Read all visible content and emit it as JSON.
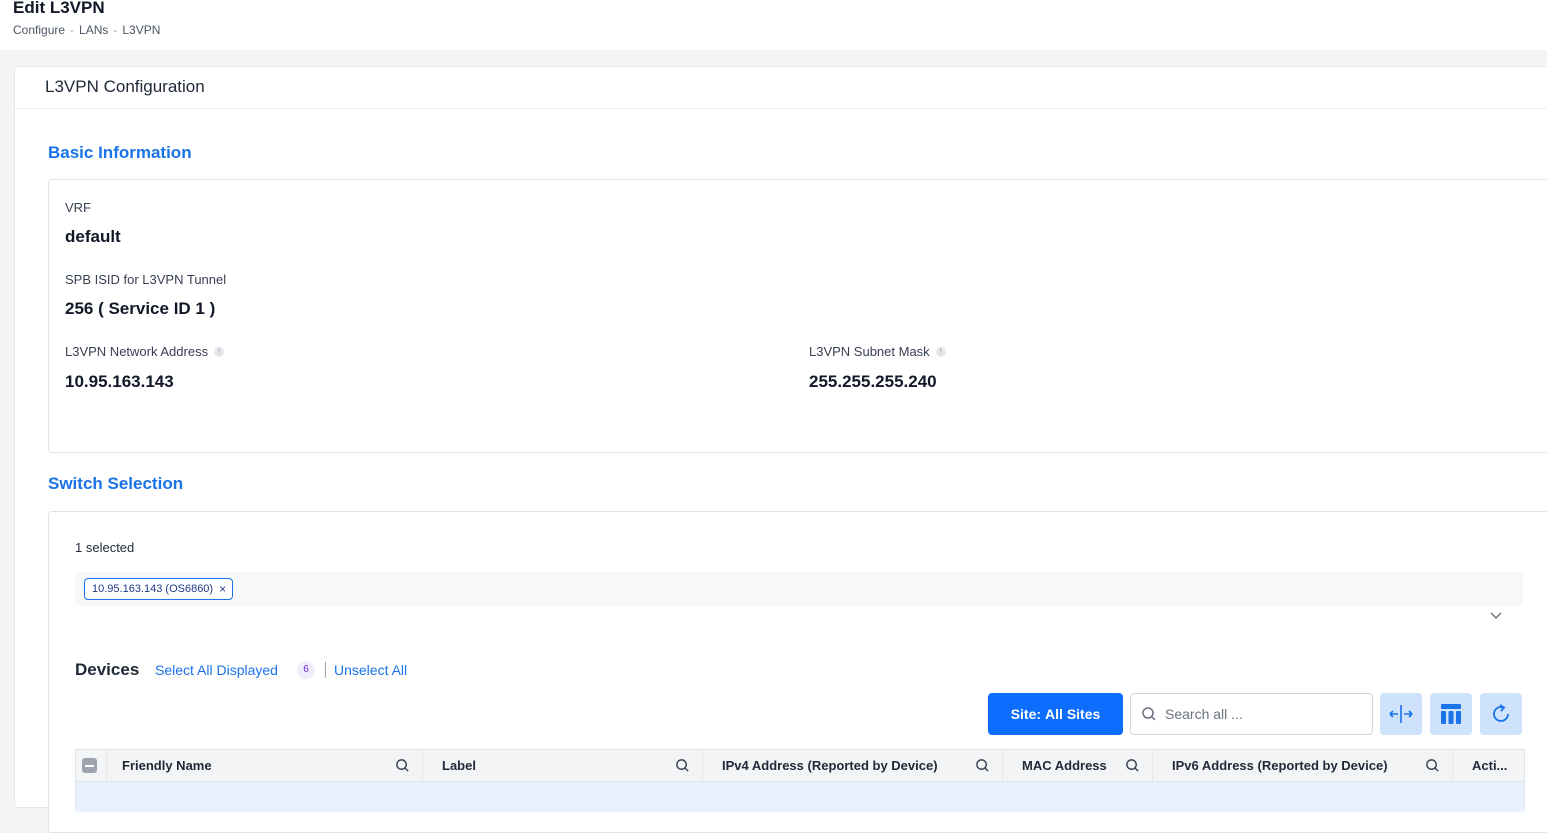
{
  "header": {
    "title": "Edit L3VPN",
    "breadcrumb": [
      "Configure",
      "LANs",
      "L3VPN"
    ],
    "separator": "-"
  },
  "panel": {
    "title": "L3VPN Configuration"
  },
  "basic_info": {
    "section_title": "Basic Information",
    "vrf_label": "VRF",
    "vrf_value": "default",
    "isid_label": "SPB ISID for L3VPN Tunnel",
    "isid_value": "256 ( Service ID 1 )",
    "network_address_label": "L3VPN Network Address",
    "network_address_value": "10.95.163.143",
    "subnet_mask_label": "L3VPN Subnet Mask",
    "subnet_mask_value": "255.255.255.240"
  },
  "switch_selection": {
    "section_title": "Switch Selection",
    "selected_count": "1 selected",
    "chips": [
      "10.95.163.143 (OS6860)"
    ],
    "chip_remove": "×"
  },
  "devices": {
    "title": "Devices",
    "select_all": "Select All Displayed",
    "count": "6",
    "unselect_all": "Unselect All",
    "site_button_prefix": "Site:",
    "site_button_value": "All Sites",
    "search_placeholder": "Search all ...",
    "columns": [
      "Friendly Name",
      "Label",
      "IPv4 Address (Reported by Device)",
      "MAC Address",
      "IPv6 Address (Reported by Device)",
      "Acti..."
    ]
  },
  "colors": {
    "accent": "#1a73e8",
    "primary_button": "#0d6efd",
    "tool_button_bg": "#cfe2fc",
    "row_highlight": "#e8f1fd"
  },
  "icons": [
    "search-icon",
    "info-icon",
    "chevron-down-icon",
    "close-icon",
    "resize-columns-icon",
    "columns-layout-icon",
    "refresh-icon"
  ]
}
